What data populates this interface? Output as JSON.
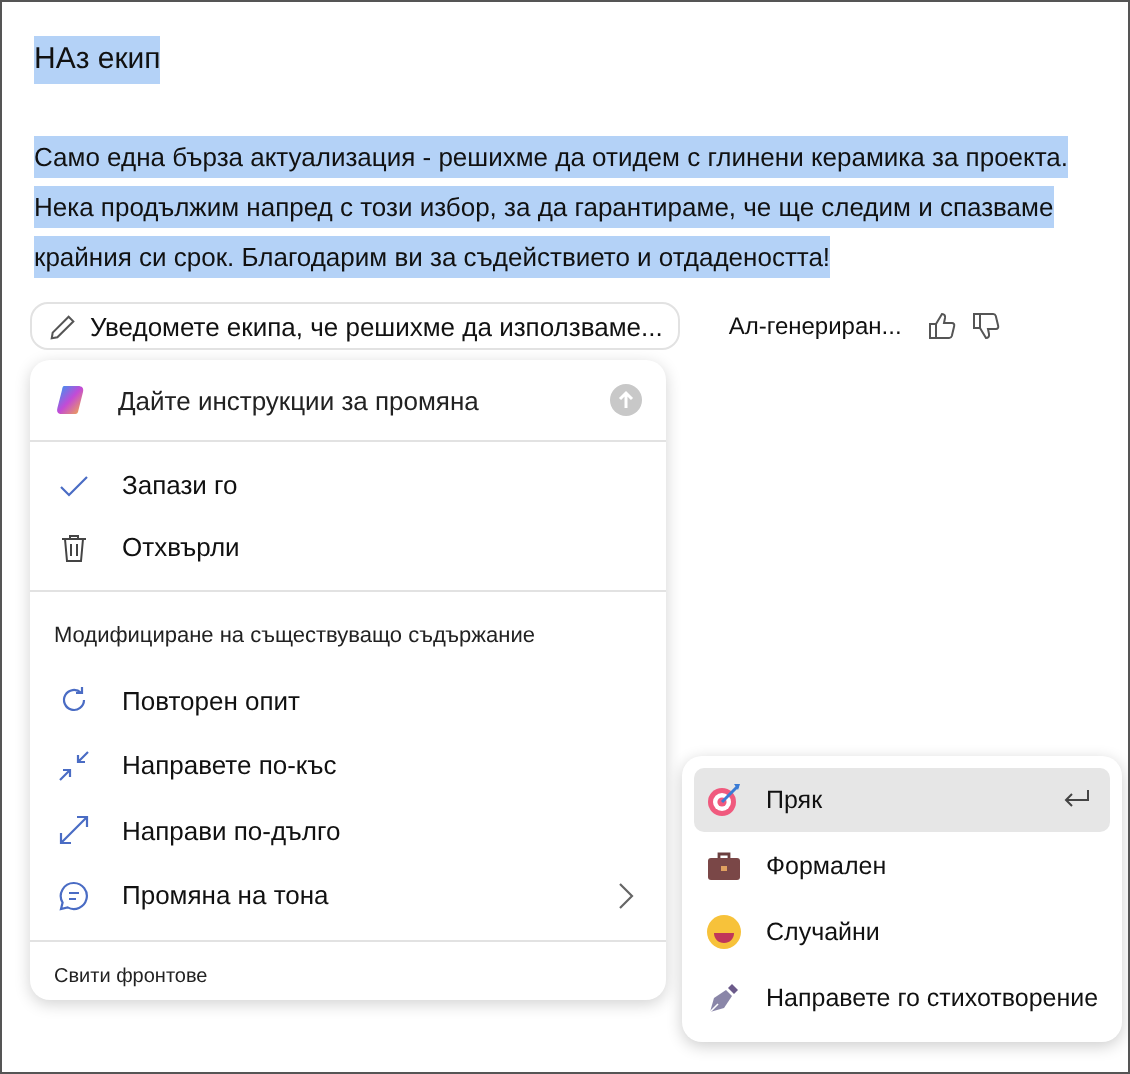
{
  "document": {
    "heading": "НАз екип",
    "selected": true,
    "paragraph": "Само една бърза актуализация - решихме да отидем с глинени керамика за проекта. Нека продължим напред с този избор, за да гарантираме, че ще следим и спазваме крайния си срок. Благодарим ви за съдействието и отдадеността!"
  },
  "prompt_chip": {
    "text": "Уведомете екипа, че решихме да използваме..."
  },
  "ai_label": "Ал-генериран...",
  "menu": {
    "input": {
      "placeholder": "Дайте инструкции за промяна"
    },
    "actions": [
      {
        "label": "Запази го",
        "kind": "check"
      },
      {
        "label": "Отхвърли",
        "kind": "trash"
      }
    ],
    "section_title": "Модифициране на съществуващо съдържание",
    "modify_items": [
      {
        "label": "Повторен опит",
        "kind": "retry",
        "submenu": false
      },
      {
        "label": "Направете по-къс",
        "kind": "shrink",
        "submenu": false
      },
      {
        "label": "Направи по-дълго",
        "kind": "expand",
        "submenu": false
      },
      {
        "label": "Промяна на тона",
        "kind": "chat",
        "submenu": true
      }
    ],
    "footer_partial": "Свити фронтове"
  },
  "tone_submenu": [
    {
      "label": "Пряк",
      "kind": "target",
      "selected": true
    },
    {
      "label": "Формален",
      "kind": "briefcase",
      "selected": false
    },
    {
      "label": "Случайни",
      "kind": "smiley",
      "selected": false
    },
    {
      "label": "Направете го стихотворение",
      "kind": "pen",
      "selected": false
    }
  ]
}
